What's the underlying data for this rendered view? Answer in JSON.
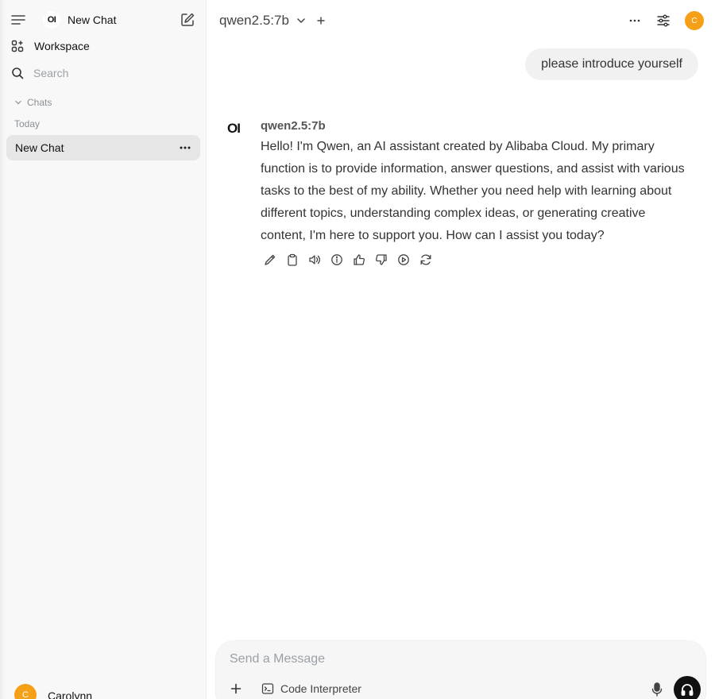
{
  "sidebar": {
    "brand_logo_text": "OI",
    "new_chat_label": "New Chat",
    "workspace_label": "Workspace",
    "search_placeholder": "Search",
    "chats_section_label": "Chats",
    "group_today_label": "Today",
    "chat_items": [
      {
        "title": "New Chat",
        "active": true
      }
    ],
    "user": {
      "initial": "C",
      "name": "Carolynn",
      "avatar_color": "#f5a017"
    }
  },
  "header": {
    "model_name": "qwen2.5:7b",
    "avatar_initial": "C",
    "avatar_color": "#f5a017"
  },
  "conversation": {
    "user_message": "please introduce yourself",
    "assistant": {
      "logo_text": "OI",
      "model_name": "qwen2.5:7b",
      "message": "Hello! I'm Qwen, an AI assistant created by Alibaba Cloud. My primary function is to provide information, answer questions, and assist with various tasks to the best of my ability. Whether you need help with learning about different topics, understanding complex ideas, or generating creative content, I'm here to support you. How can I assist you today?",
      "actions": [
        "edit-icon",
        "copy-icon",
        "read-aloud-icon",
        "info-icon",
        "thumbs-up-icon",
        "thumbs-down-icon",
        "continue-icon",
        "regenerate-icon"
      ]
    }
  },
  "composer": {
    "placeholder": "Send a Message",
    "value": "",
    "code_interpreter_label": "Code Interpreter"
  }
}
